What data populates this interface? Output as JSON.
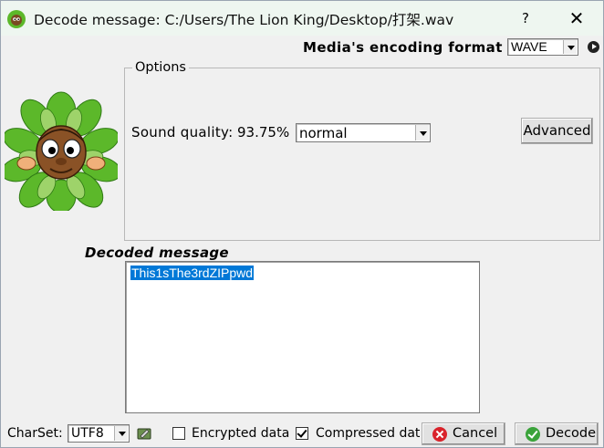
{
  "window": {
    "title": "Decode message: C:/Users/The Lion King/Desktop/打架.wav",
    "help_label": "?",
    "close_label": "✕"
  },
  "encoding": {
    "label": "Media's encoding format :",
    "value": "WAVE"
  },
  "options": {
    "legend": "Options",
    "sound_quality_label": "Sound quality:",
    "sound_quality_percent": "93.75%",
    "quality_value": "normal",
    "advanced_label": "Advanced"
  },
  "decoded": {
    "label": "Decoded message",
    "text": "This1sThe3rdZIPpwd"
  },
  "bottom": {
    "charset_label": "CharSet:",
    "charset_value": "UTF8",
    "encrypted_label": "Encrypted data",
    "encrypted_checked": false,
    "compressed_label": "Compressed dat",
    "compressed_checked": true,
    "cancel_label": "Cancel",
    "decode_label": "Decode"
  },
  "colors": {
    "selection": "#0078d7",
    "mascot_leaves": "#5cb82a",
    "cancel_icon": "#d9232b",
    "decode_icon": "#3aa33a"
  }
}
